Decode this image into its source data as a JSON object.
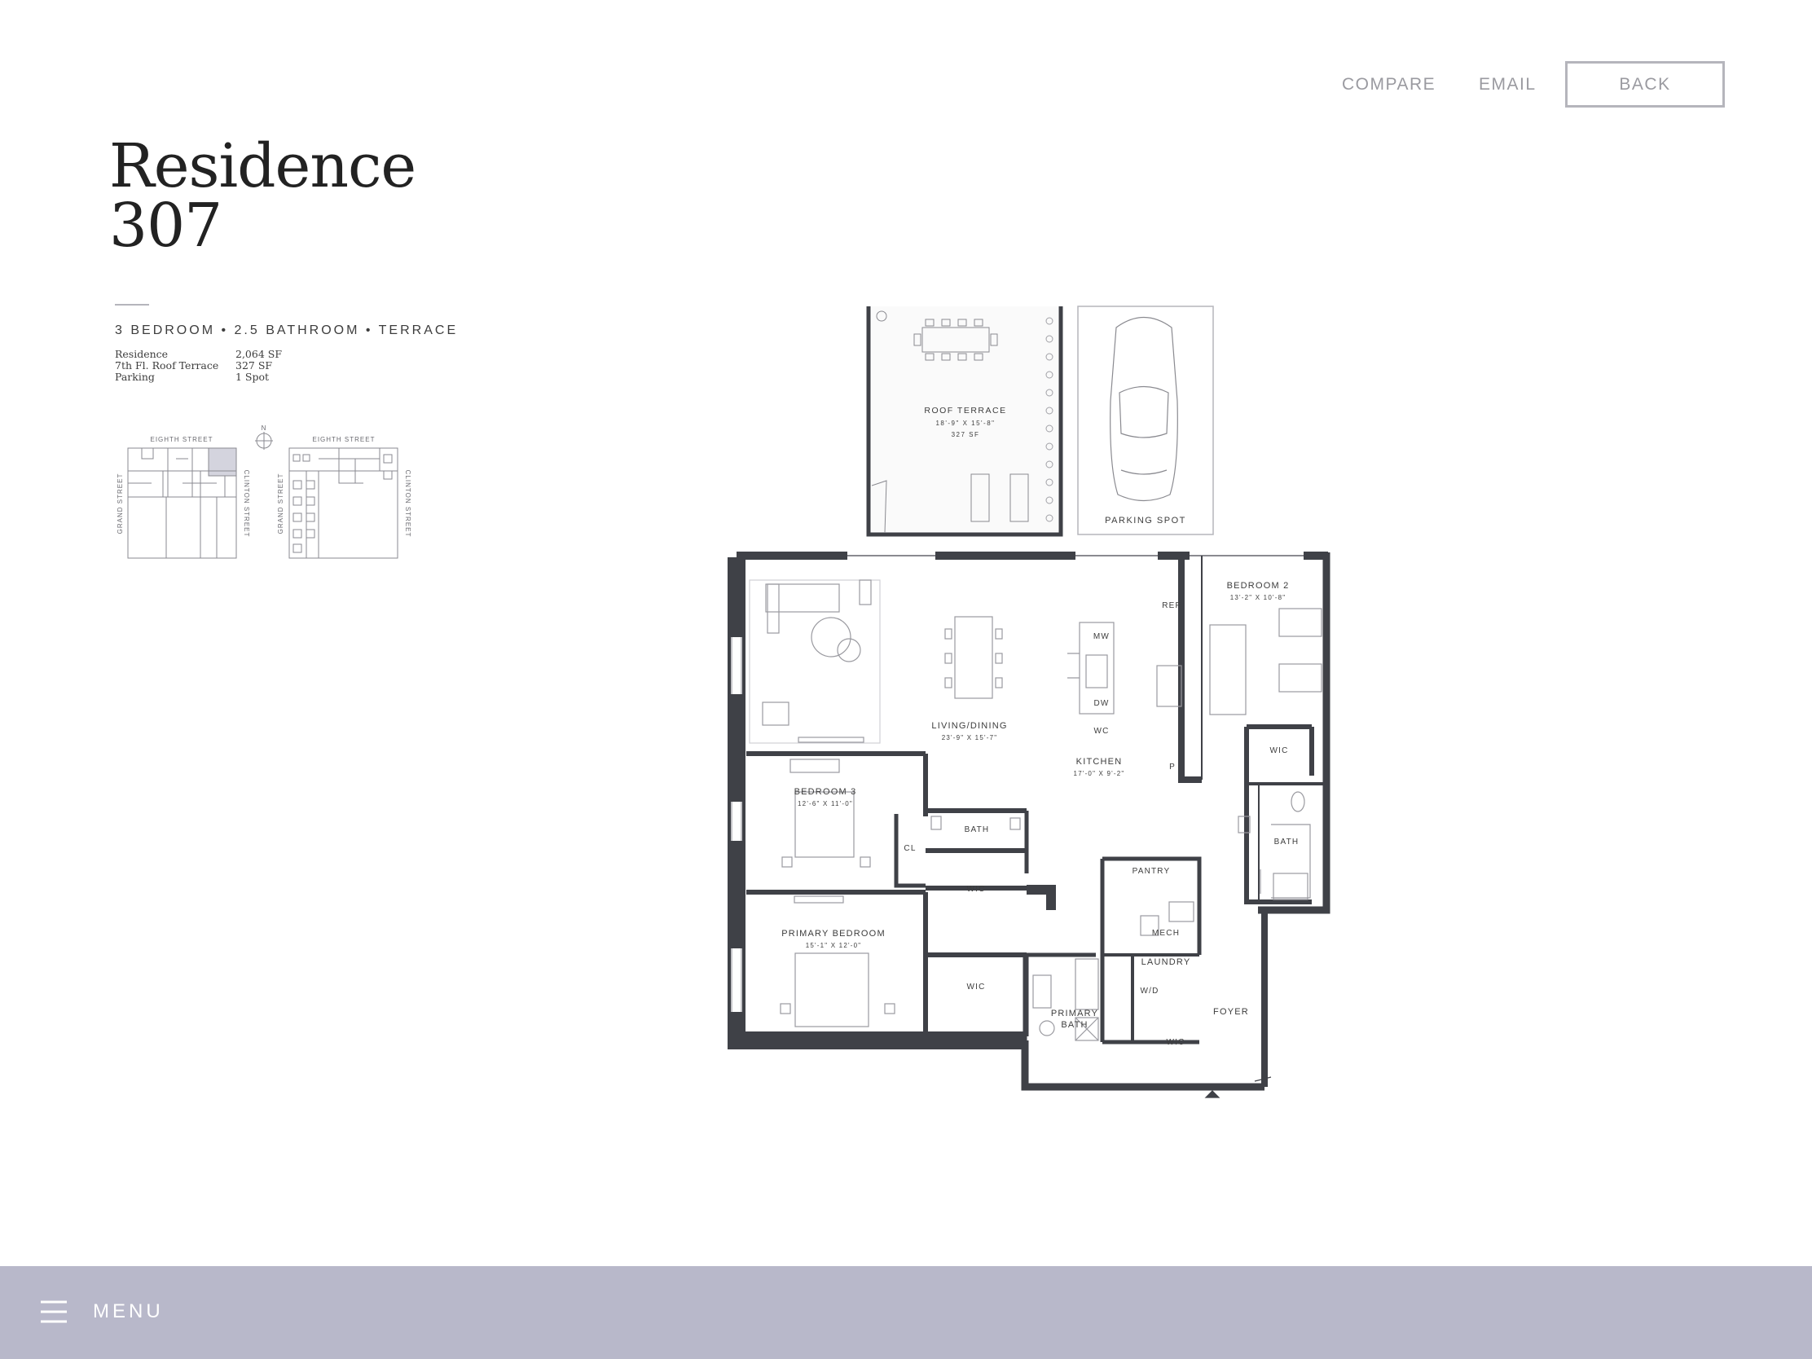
{
  "header": {
    "compare_label": "COMPARE",
    "email_label": "EMAIL",
    "back_label": "BACK"
  },
  "residence": {
    "title_line1": "Residence",
    "title_line2": "307",
    "specs": "3 BEDROOM • 2.5 BATHROOM • TERRACE",
    "areas": [
      {
        "label": "Residence",
        "value": "2,064 SF"
      },
      {
        "label": "7th Fl. Roof Terrace",
        "value": "327 SF"
      },
      {
        "label": "Parking",
        "value": "1 Spot"
      }
    ]
  },
  "keyplan": {
    "north": "N",
    "left": {
      "top": "EIGHTH STREET",
      "left": "GRAND STREET",
      "right": "CLINTON STREET"
    },
    "right": {
      "top": "EIGHTH STREET",
      "left": "GRAND STREET",
      "right": "CLINTON STREET"
    }
  },
  "floorplan": {
    "roof_terrace": {
      "name": "ROOF TERRACE",
      "dims": "18'-9\" X 15'-8\"",
      "area": "327 SF"
    },
    "parking": {
      "name": "PARKING SPOT"
    },
    "rooms": {
      "living": {
        "name": "LIVING/DINING",
        "dims": "23'-9\" X 15'-7\""
      },
      "kitchen": {
        "name": "KITCHEN",
        "dims": "17'-0\" X 9'-2\""
      },
      "bedroom2": {
        "name": "BEDROOM 2",
        "dims": "13'-2\" X 10'-8\""
      },
      "bedroom3": {
        "name": "BEDROOM 3",
        "dims": "12'-6\" X 11'-0\""
      },
      "primary": {
        "name": "PRIMARY BEDROOM",
        "dims": "15'-1\" X 12'-0\""
      },
      "primary_bath_1": "PRIMARY",
      "primary_bath_2": "BATH",
      "foyer": "FOYER",
      "pantry": "PANTRY",
      "mech": "MECH",
      "laundry": "LAUNDRY",
      "wd": "W/D",
      "bath": "BATH",
      "wic": "WIC",
      "cl": "CL",
      "ref": "REF",
      "mw": "MW",
      "dw": "DW",
      "wc": "WC",
      "p": "P"
    }
  },
  "footer": {
    "menu_label": "MENU"
  },
  "colors": {
    "wall": "#3f4147",
    "menu_bar": "#b8b8ca",
    "highlight": "#d4d4de"
  }
}
